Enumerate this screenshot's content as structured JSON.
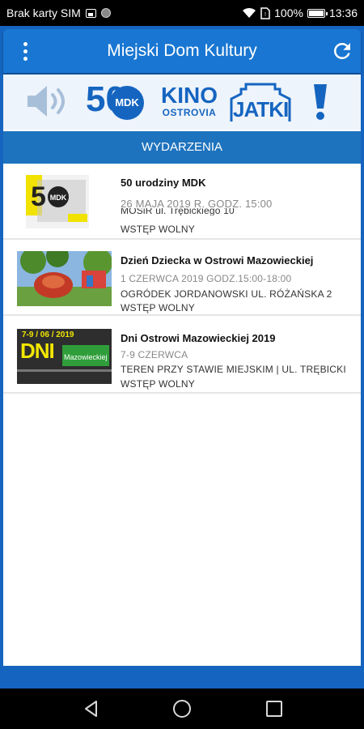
{
  "status_bar": {
    "carrier": "Brak karty SIM",
    "battery": "100%",
    "time": "13:36"
  },
  "app_bar": {
    "title": "Miejski Dom Kultury",
    "menu_icon": "more-vert-icon",
    "refresh_icon": "refresh-icon"
  },
  "logos": {
    "mdk_number": "50",
    "mdk_text": "MDK",
    "kino_title": "KINO",
    "kino_subtitle": "OSTROVIA",
    "jatki": "JATKI"
  },
  "section": {
    "title": "WYDARZENIA"
  },
  "events": [
    {
      "title": "50 urodziny MDK",
      "date": "26 MAJA 2019 R. GODZ. 15:00",
      "place": "MOSiR ul. Trębickiego 10",
      "entry": "WSTĘP WOLNY"
    },
    {
      "title": "Dzień Dziecka w Ostrowi Mazowieckiej",
      "date": "1 CZERWCA 2019 GODZ.15:00-18:00",
      "place": "OGRÓDEK JORDANOWSKI UL. RÓŻAŃSKA 2",
      "entry": "WSTĘP WOLNY"
    },
    {
      "title": "Dni Ostrowi Mazowieckiej 2019",
      "date": "7-9 CZERWCA",
      "place": "TEREN PRZY STAWIE MIEJSKIM | UL. TRĘBICKI",
      "entry": "WSTĘP WOLNY"
    }
  ],
  "thumb3": {
    "date": "7-9 / 06 / 2019",
    "big": "DNI",
    "sub": "Mazowieckiej"
  },
  "colors": {
    "primary": "#1976d2",
    "primary_dark": "#1565c0",
    "section": "#1e73be"
  }
}
